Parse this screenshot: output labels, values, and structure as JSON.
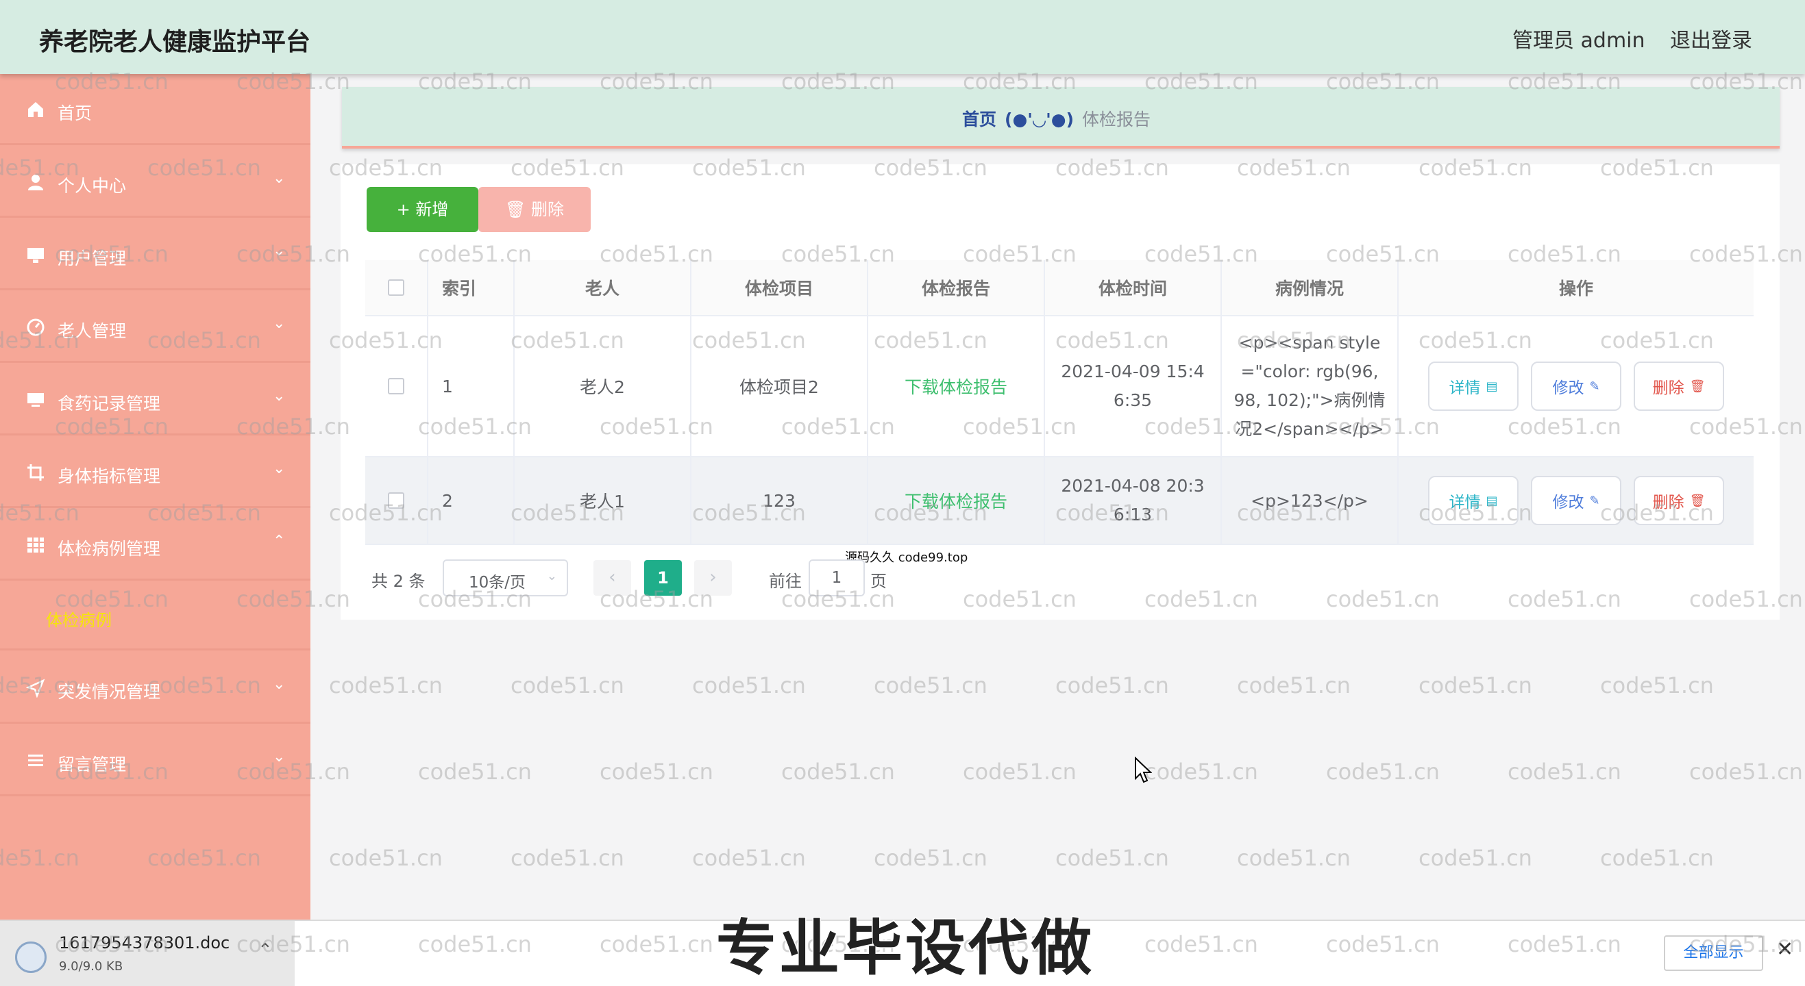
{
  "header": {
    "title": "养老院老人健康监护平台",
    "admin": "管理员 admin",
    "logout": "退出登录"
  },
  "sidebar": {
    "items": [
      {
        "label": "首页",
        "icon": "home-icon",
        "arrow": ""
      },
      {
        "label": "个人中心",
        "icon": "user-icon",
        "arrow": "⌄"
      },
      {
        "label": "用户管理",
        "icon": "monitor-icon",
        "arrow": "⌄"
      },
      {
        "label": "老人管理",
        "icon": "gauge-icon",
        "arrow": "⌄"
      },
      {
        "label": "食药记录管理",
        "icon": "screen-icon",
        "arrow": "⌄"
      },
      {
        "label": "身体指标管理",
        "icon": "crop-icon",
        "arrow": "⌄"
      },
      {
        "label": "体检病例管理",
        "icon": "grid-icon",
        "arrow": "⌃"
      },
      {
        "label": "突发情况管理",
        "icon": "send-icon",
        "arrow": "⌄"
      },
      {
        "label": "留言管理",
        "icon": "list-icon",
        "arrow": "⌄"
      }
    ],
    "sub_item": "体检病例"
  },
  "breadcrumb": {
    "home": "首页",
    "sep": "(●'◡'●)",
    "current": "体检报告"
  },
  "toolbar": {
    "add": "+ 新增",
    "delete": "删除"
  },
  "table": {
    "headers": [
      "索引",
      "老人",
      "体检项目",
      "体检报告",
      "体检时间",
      "病例情况",
      "操作"
    ],
    "rows": [
      {
        "index": "1",
        "elder": "老人2",
        "item": "体检项目2",
        "report": "下载体检报告",
        "time": "2021-04-09 15:46:35",
        "case": "<p><span style=\"color: rgb(96, 98, 102);\">病例情况2</span></p>"
      },
      {
        "index": "2",
        "elder": "老人1",
        "item": "123",
        "report": "下载体检报告",
        "time": "2021-04-08 20:36:13",
        "case": "<p>123</p>"
      }
    ],
    "ops": {
      "detail": "详情",
      "edit": "修改",
      "remove": "删除"
    },
    "overlay": "源码久久 code99.top"
  },
  "pagination": {
    "total": "共 2 条",
    "page_size": "10条/页",
    "current": "1",
    "goto_label": "前往",
    "goto_value": "1",
    "page_unit": "页"
  },
  "download_bar": {
    "filename": "1617954378301.doc",
    "size": "9.0/9.0 KB",
    "show_all": "全部显示",
    "close": "✕"
  },
  "caption": "专业毕设代做",
  "watermark": "code51.cn",
  "colors": {
    "header_bg": "#d6ece2",
    "sidebar_bg": "#f6a797",
    "add_button": "#46b13c",
    "active_page": "#1fae8a",
    "link": "#3fbf6f"
  }
}
